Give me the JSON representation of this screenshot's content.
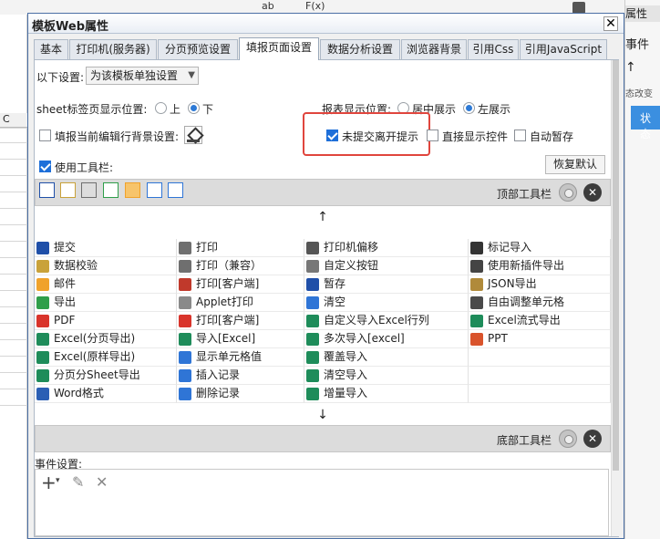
{
  "background": {
    "right_panel": {
      "header": "属性",
      "event_label": "事件",
      "arrow_glyph": "↑",
      "status_text": "态改变",
      "state_button": "状态"
    },
    "grid_col_label": "C",
    "toolbar_glyphs": [
      "ab",
      "F(x)"
    ]
  },
  "dialog": {
    "title": "模板Web属性",
    "close_glyph": "✕",
    "tabs": [
      "基本",
      "打印机(服务器)",
      "分页预览设置",
      "填报页面设置",
      "数据分析设置",
      "浏览器背景",
      "引用Css",
      "引用JavaScript"
    ],
    "active_tab": 3,
    "settings": {
      "following_label": "以下设置:",
      "following_value": "为该模板单独设置",
      "sheet_tab_label": "sheet标签页显示位置:",
      "sheet_opt_up": "上",
      "sheet_opt_down": "下",
      "sheet_selected": "下",
      "report_pos_label": "报表显示位置:",
      "report_opt_center": "居中展示",
      "report_opt_left": "左展示",
      "report_selected": "左展示",
      "fill_bg_label": "填报当前编辑行背景设置:",
      "unsubmitted_prompt": "未提交离开提示",
      "unsubmitted_checked": true,
      "direct_show": "直接显示控件",
      "auto_save": "自动暂存",
      "use_toolbar": "使用工具栏:",
      "use_toolbar_checked": true,
      "restore_default": "恢复默认"
    },
    "top_toolbar_label": "顶部工具栏",
    "bottom_toolbar_label": "底部工具栏",
    "up_arrow": "↑",
    "down_arrow": "↓",
    "toolbar_top_icons": [
      "save-icon",
      "verify-icon",
      "print-icon",
      "export-icon",
      "email-icon",
      "insert-row-icon",
      "blank-icon"
    ],
    "items": [
      [
        {
          "icon": "save",
          "text": "提交",
          "color": "#1f4fa8"
        },
        {
          "icon": "print",
          "text": "打印",
          "color": "#6f6f6f"
        },
        {
          "icon": "move",
          "text": "打印机偏移",
          "color": "#555555"
        },
        {
          "icon": "mark",
          "text": "标记导入",
          "color": "#333333"
        }
      ],
      [
        {
          "icon": "verify",
          "text": "数据校验",
          "color": "#c9a23a"
        },
        {
          "icon": "print",
          "text": "打印（兼容）",
          "color": "#6f6f6f"
        },
        {
          "icon": "gear",
          "text": "自定义按钮",
          "color": "#777777"
        },
        {
          "icon": "web",
          "text": "使用新插件导出",
          "color": "#444444"
        }
      ],
      [
        {
          "icon": "mail",
          "text": "邮件",
          "color": "#f0a22b"
        },
        {
          "icon": "flash",
          "text": "打印[客户端]",
          "color": "#c0392b"
        },
        {
          "icon": "stash",
          "text": "暂存",
          "color": "#1f4fa8"
        },
        {
          "icon": "json",
          "text": "JSON导出",
          "color": "#b08a3a"
        }
      ],
      [
        {
          "icon": "export",
          "text": "导出",
          "color": "#2f9e4a"
        },
        {
          "icon": "applet",
          "text": "Applet打印",
          "color": "#8a8a8a"
        },
        {
          "icon": "clear",
          "text": "清空",
          "color": "#2f75d6"
        },
        {
          "icon": "table",
          "text": "自由调整单元格",
          "color": "#4a4a4a"
        }
      ],
      [
        {
          "icon": "pdf",
          "text": "PDF",
          "color": "#d9342b"
        },
        {
          "icon": "pdf",
          "text": "打印[客户端]",
          "color": "#d9342b"
        },
        {
          "icon": "excel",
          "text": "自定义导入Excel行列",
          "color": "#1e8c5a"
        },
        {
          "icon": "excel",
          "text": "Excel流式导出",
          "color": "#1e8c5a"
        }
      ],
      [
        {
          "icon": "excel",
          "text": "Excel(分页导出)",
          "color": "#1e8c5a"
        },
        {
          "icon": "excel",
          "text": "导入[Excel]",
          "color": "#1e8c5a"
        },
        {
          "icon": "excel",
          "text": "多次导入[excel]",
          "color": "#1e8c5a"
        },
        {
          "icon": "ppt",
          "text": "PPT",
          "color": "#d9532b"
        }
      ],
      [
        {
          "icon": "excel",
          "text": "Excel(原样导出)",
          "color": "#1e8c5a"
        },
        {
          "icon": "cellval",
          "text": "显示单元格值",
          "color": "#2f75d6"
        },
        {
          "icon": "excel",
          "text": "覆盖导入",
          "color": "#1e8c5a"
        },
        {
          "icon": "",
          "text": "",
          "color": ""
        }
      ],
      [
        {
          "icon": "excel",
          "text": "分页分Sheet导出",
          "color": "#1e8c5a"
        },
        {
          "icon": "insert",
          "text": "插入记录",
          "color": "#2f75d6"
        },
        {
          "icon": "excel",
          "text": "清空导入",
          "color": "#1e8c5a"
        },
        {
          "icon": "",
          "text": "",
          "color": ""
        }
      ],
      [
        {
          "icon": "word",
          "text": "Word格式",
          "color": "#2b5fb4"
        },
        {
          "icon": "delete",
          "text": "删除记录",
          "color": "#2f75d6"
        },
        {
          "icon": "excel",
          "text": "增量导入",
          "color": "#1e8c5a"
        },
        {
          "icon": "",
          "text": "",
          "color": ""
        }
      ]
    ],
    "events_label": "事件设置:",
    "event_add": "+",
    "event_add_caret": "▾",
    "event_edit": "✎",
    "event_delete": "✕"
  }
}
